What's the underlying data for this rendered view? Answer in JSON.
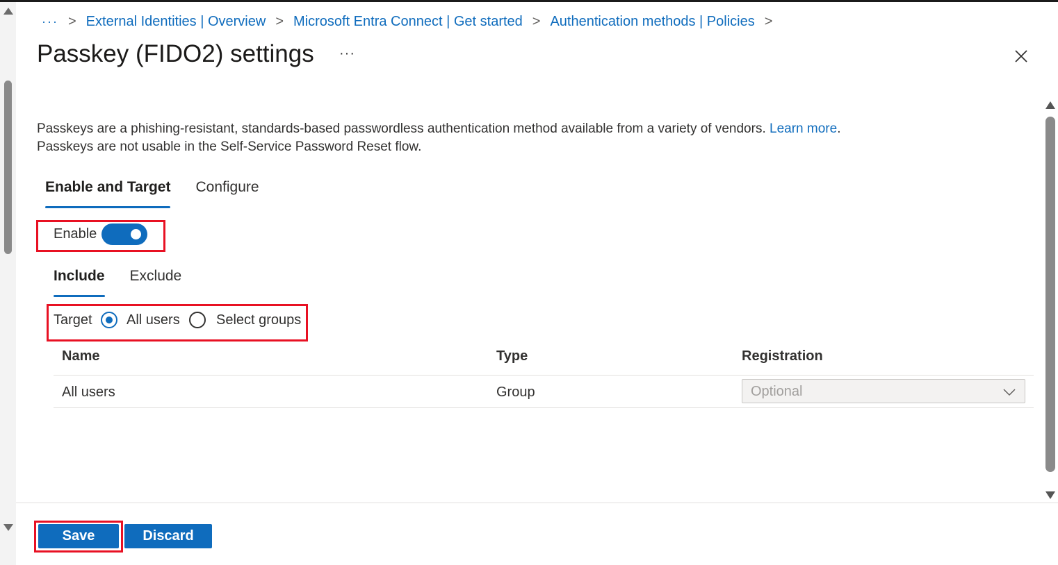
{
  "breadcrumb": {
    "ellipsis": "···",
    "items": [
      {
        "label": "External Identities | Overview"
      },
      {
        "label": "Microsoft Entra Connect | Get started"
      },
      {
        "label": "Authentication methods | Policies"
      }
    ],
    "separator": ">"
  },
  "header": {
    "title": "Passkey (FIDO2) settings",
    "more": "···"
  },
  "description": {
    "line1": "Passkeys are a phishing-resistant, standards-based passwordless authentication method available from a variety of vendors.",
    "learn_more": "Learn more",
    "period": ".",
    "line2": "Passkeys are not usable in the Self-Service Password Reset flow."
  },
  "main_tabs": [
    {
      "label": "Enable and Target",
      "active": true
    },
    {
      "label": "Configure",
      "active": false
    }
  ],
  "enable": {
    "label": "Enable",
    "value": true
  },
  "scope_tabs": [
    {
      "label": "Include",
      "active": true
    },
    {
      "label": "Exclude",
      "active": false
    }
  ],
  "target": {
    "label": "Target",
    "options": [
      {
        "label": "All users",
        "checked": true
      },
      {
        "label": "Select groups",
        "checked": false
      }
    ]
  },
  "table": {
    "headers": [
      "Name",
      "Type",
      "Registration"
    ],
    "rows": [
      {
        "name": "All users",
        "type": "Group",
        "registration": "Optional"
      }
    ]
  },
  "footer": {
    "save_label": "Save",
    "discard_label": "Discard"
  },
  "colors": {
    "accent": "#0f6cbd",
    "highlight": "#e81123"
  }
}
